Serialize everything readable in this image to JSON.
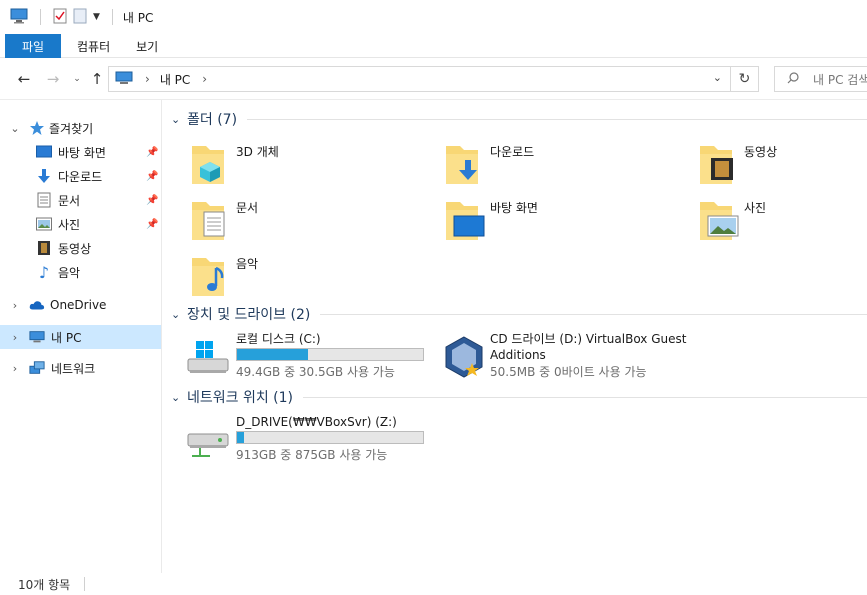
{
  "window": {
    "title": "내 PC"
  },
  "ribbon": {
    "tabs": [
      "파일",
      "컴퓨터",
      "보기"
    ]
  },
  "address": {
    "crumb": "내 PC",
    "separator": "›"
  },
  "search": {
    "placeholder": "내 PC 검색"
  },
  "sidebar": {
    "items": [
      {
        "label": "즐겨찾기",
        "icon": "star-icon"
      },
      {
        "label": "바탕 화면",
        "icon": "desktop-icon",
        "pinned": true
      },
      {
        "label": "다운로드",
        "icon": "download-icon",
        "pinned": true
      },
      {
        "label": "문서",
        "icon": "documents-icon",
        "pinned": true
      },
      {
        "label": "사진",
        "icon": "pictures-icon",
        "pinned": true
      },
      {
        "label": "동영상",
        "icon": "videos-icon"
      },
      {
        "label": "음악",
        "icon": "music-icon"
      },
      {
        "label": "OneDrive",
        "icon": "onedrive-icon"
      },
      {
        "label": "내 PC",
        "icon": "this-pc-icon",
        "selected": true
      },
      {
        "label": "네트워크",
        "icon": "network-icon"
      }
    ]
  },
  "groups": {
    "folders": {
      "title": "폴더 (7)",
      "items": [
        "3D 개체",
        "다운로드",
        "동영상",
        "문서",
        "바탕 화면",
        "사진",
        "음악"
      ]
    },
    "devices": {
      "title": "장치 및 드라이브 (2)",
      "items": [
        {
          "name": "로컬 디스크 (C:)",
          "free": "49.4GB 중 30.5GB 사용 가능",
          "used_fraction": 0.38
        },
        {
          "name": "CD 드라이브 (D:) VirtualBox Guest Additions",
          "free": "50.5MB 중 0바이트 사용 가능"
        }
      ]
    },
    "network": {
      "title": "네트워크 위치 (1)",
      "items": [
        {
          "name": "D_DRIVE(₩₩VBoxSvr) (Z:)",
          "free": "913GB 중 875GB 사용 가능",
          "used_fraction": 0.04
        }
      ]
    }
  },
  "status": {
    "count": "10개 항목"
  },
  "colors": {
    "accent": "#1979ca",
    "selection": "#cce8ff",
    "bar": "#26a0da",
    "folder": "#f8d775"
  }
}
